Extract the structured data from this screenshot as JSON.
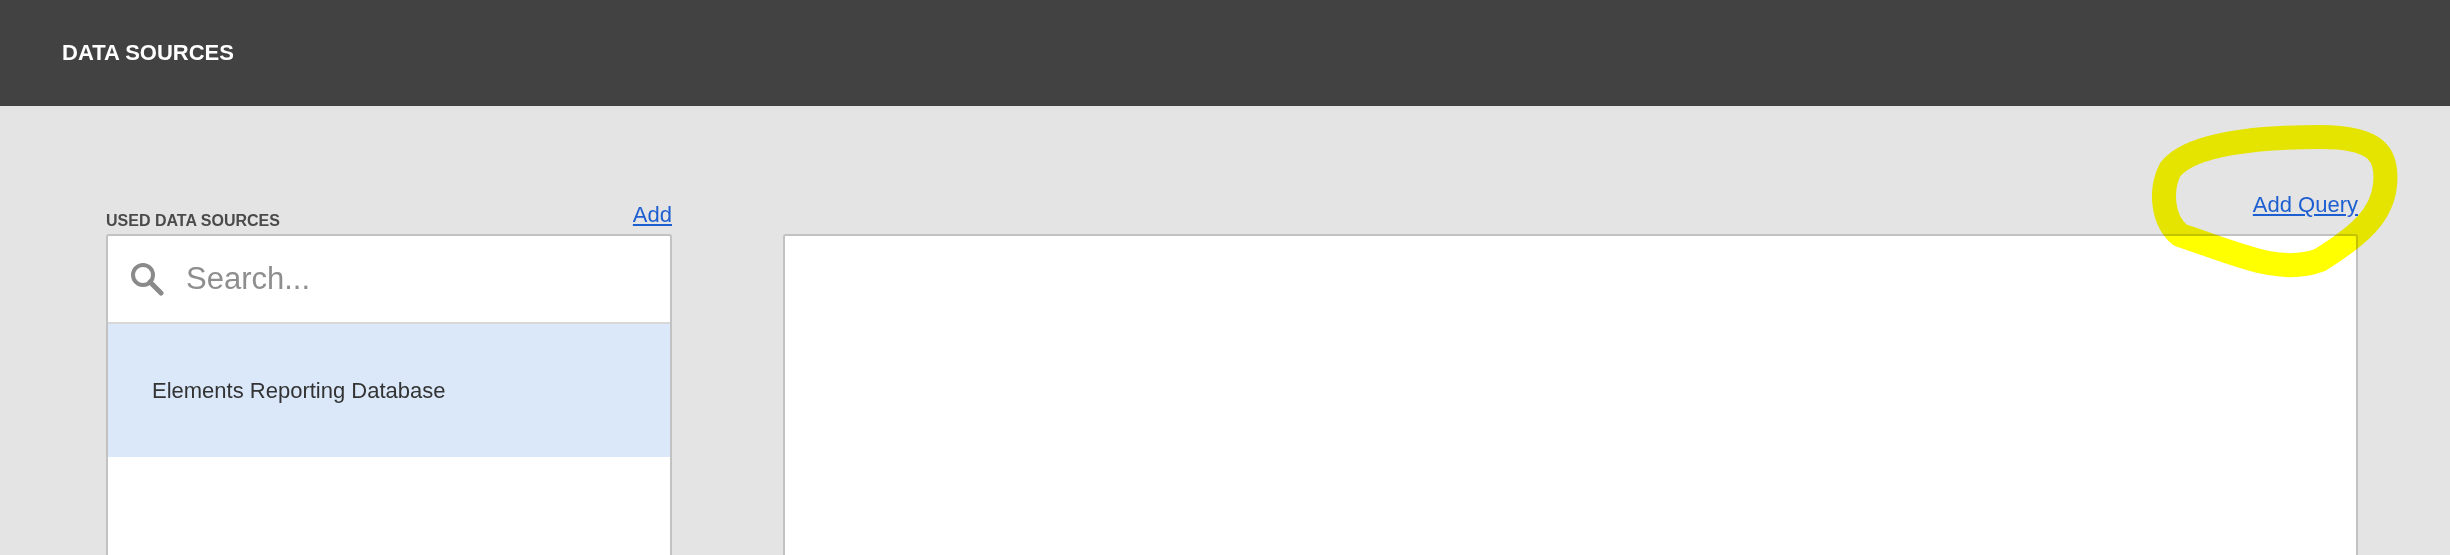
{
  "header": {
    "title": "DATA SOURCES"
  },
  "sources": {
    "label": "USED DATA SOURCES",
    "add_link": "Add",
    "search": {
      "placeholder": "Search..."
    },
    "items": [
      {
        "label": "Elements Reporting Database",
        "selected": true
      }
    ]
  },
  "queries": {
    "add_link": "Add Query"
  }
}
